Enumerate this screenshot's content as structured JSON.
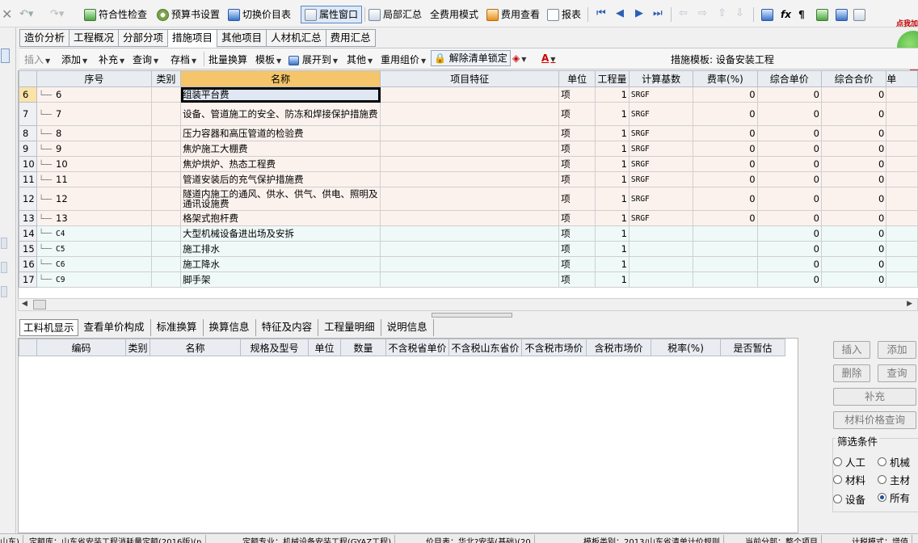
{
  "toolbar": {
    "check_label": "符合性检查",
    "budget_settings_label": "预算书设置",
    "switch_price_table_label": "切换价目表",
    "property_window_label": "属性窗口",
    "partial_summary_label": "局部汇总",
    "full_cost_mode_label": "全费用模式",
    "cost_view_label": "费用查看",
    "report_label": "报表",
    "fx_label": "fx",
    "pilcrow_label": "¶",
    "badge_text": "点我加"
  },
  "main_tabs": [
    {
      "label": "造价分析"
    },
    {
      "label": "工程概况"
    },
    {
      "label": "分部分项"
    },
    {
      "label": "措施项目"
    },
    {
      "label": "其他项目"
    },
    {
      "label": "人材机汇总"
    },
    {
      "label": "费用汇总"
    }
  ],
  "toolbar2": {
    "insert": "插入",
    "add": "添加",
    "supplement": "补充",
    "query": "查询",
    "save_file": "存档",
    "batch_convert": "批量换算",
    "template": "模板",
    "expand_to": "展开到",
    "other": "其他",
    "reuse_pricing": "重用组价",
    "unlock_list": "解除清单锁定",
    "font_color_letter": "A",
    "measure_template_label": "措施模板:",
    "measure_template_value": "设备安装工程"
  },
  "grid": {
    "headers": {
      "seq": "序号",
      "category": "类别",
      "name": "名称",
      "feature": "项目特征",
      "unit": "单位",
      "quantity": "工程量",
      "base": "计算基数",
      "rate": "费率(%)",
      "unit_price": "综合单价",
      "total_price": "综合合价",
      "overflow": "单"
    },
    "rows": [
      {
        "row": "6",
        "seq": "6",
        "name": "组装平台费",
        "unit": "项",
        "qty": "1",
        "base": "SRGF",
        "rate": "0",
        "unit_price": "0",
        "total": "0"
      },
      {
        "row": "7",
        "seq": "7",
        "name": "设备、管道施工的安全、防冻和焊接保护措施费",
        "unit": "项",
        "qty": "1",
        "base": "SRGF",
        "rate": "0",
        "unit_price": "0",
        "total": "0"
      },
      {
        "row": "8",
        "seq": "8",
        "name": "压力容器和高压管道的检验费",
        "unit": "项",
        "qty": "1",
        "base": "SRGF",
        "rate": "0",
        "unit_price": "0",
        "total": "0"
      },
      {
        "row": "9",
        "seq": "9",
        "name": "焦炉施工大棚费",
        "unit": "项",
        "qty": "1",
        "base": "SRGF",
        "rate": "0",
        "unit_price": "0",
        "total": "0"
      },
      {
        "row": "10",
        "seq": "10",
        "name": "焦炉烘炉、热态工程费",
        "unit": "项",
        "qty": "1",
        "base": "SRGF",
        "rate": "0",
        "unit_price": "0",
        "total": "0"
      },
      {
        "row": "11",
        "seq": "11",
        "name": "管道安装后的充气保护措施费",
        "unit": "项",
        "qty": "1",
        "base": "SRGF",
        "rate": "0",
        "unit_price": "0",
        "total": "0"
      },
      {
        "row": "12",
        "seq": "12",
        "name": "隧道内施工的通风、供水、供气、供电、照明及通讯设施费",
        "unit": "项",
        "qty": "1",
        "base": "SRGF",
        "rate": "0",
        "unit_price": "0",
        "total": "0"
      },
      {
        "row": "13",
        "seq": "13",
        "name": "格架式抱杆费",
        "unit": "项",
        "qty": "1",
        "base": "SRGF",
        "rate": "0",
        "unit_price": "0",
        "total": "0"
      },
      {
        "row": "14",
        "seq": "C4",
        "name": "大型机械设备进出场及安拆",
        "unit": "项",
        "qty": "1",
        "base": "",
        "rate": "",
        "unit_price": "0",
        "total": "0"
      },
      {
        "row": "15",
        "seq": "C5",
        "name": "施工排水",
        "unit": "项",
        "qty": "1",
        "base": "",
        "rate": "",
        "unit_price": "0",
        "total": "0"
      },
      {
        "row": "16",
        "seq": "C6",
        "name": "施工降水",
        "unit": "项",
        "qty": "1",
        "base": "",
        "rate": "",
        "unit_price": "0",
        "total": "0"
      },
      {
        "row": "17",
        "seq": "C9",
        "name": "脚手架",
        "unit": "项",
        "qty": "1",
        "base": "",
        "rate": "",
        "unit_price": "0",
        "total": "0"
      }
    ]
  },
  "bottom_tabs": [
    {
      "label": "工料机显示"
    },
    {
      "label": "查看单价构成"
    },
    {
      "label": "标准换算"
    },
    {
      "label": "换算信息"
    },
    {
      "label": "特征及内容"
    },
    {
      "label": "工程量明细"
    },
    {
      "label": "说明信息"
    }
  ],
  "grid2": {
    "headers": {
      "code": "编码",
      "category": "类别",
      "name": "名称",
      "spec": "规格及型号",
      "unit": "单位",
      "quantity": "数量",
      "ex_tax_province": "不含税省单价",
      "ex_tax_shandong": "不含税山东省价",
      "ex_tax_market": "不含税市场价",
      "in_tax_market": "含税市场价",
      "tax_rate": "税率(%)",
      "is_provisional": "是否暂估"
    }
  },
  "right_panel": {
    "insert": "插入",
    "add": "添加",
    "delete": "删除",
    "query": "查询",
    "supplement": "补充",
    "material_price_query": "材料价格查询",
    "filter_title": "筛选条件",
    "filters": {
      "labor": "人工",
      "machine": "机械",
      "material": "材料",
      "main_material": "主材",
      "equipment": "设备",
      "all": "所有"
    },
    "selected_filter": "所有"
  },
  "status_bar": {
    "s1": "山东)",
    "s2": "定额库：山东省安装工程消耗量定额(2016版)(n",
    "s3": "定额专业：机械设备安装工程(GYAZ工程)",
    "s4": "价目表：华北?安装(基础)(20",
    "s5": "模板类别：2013/山东省清单计价规则",
    "s6": "当前分部：整个项目",
    "s7": "计税模式：增值"
  },
  "colors": {
    "measure_row_bg": "#fbf2ee",
    "total_row_bg": "#effaf8",
    "selected_header": "#f4c56b",
    "nav_blue": "#2d5fb5"
  }
}
